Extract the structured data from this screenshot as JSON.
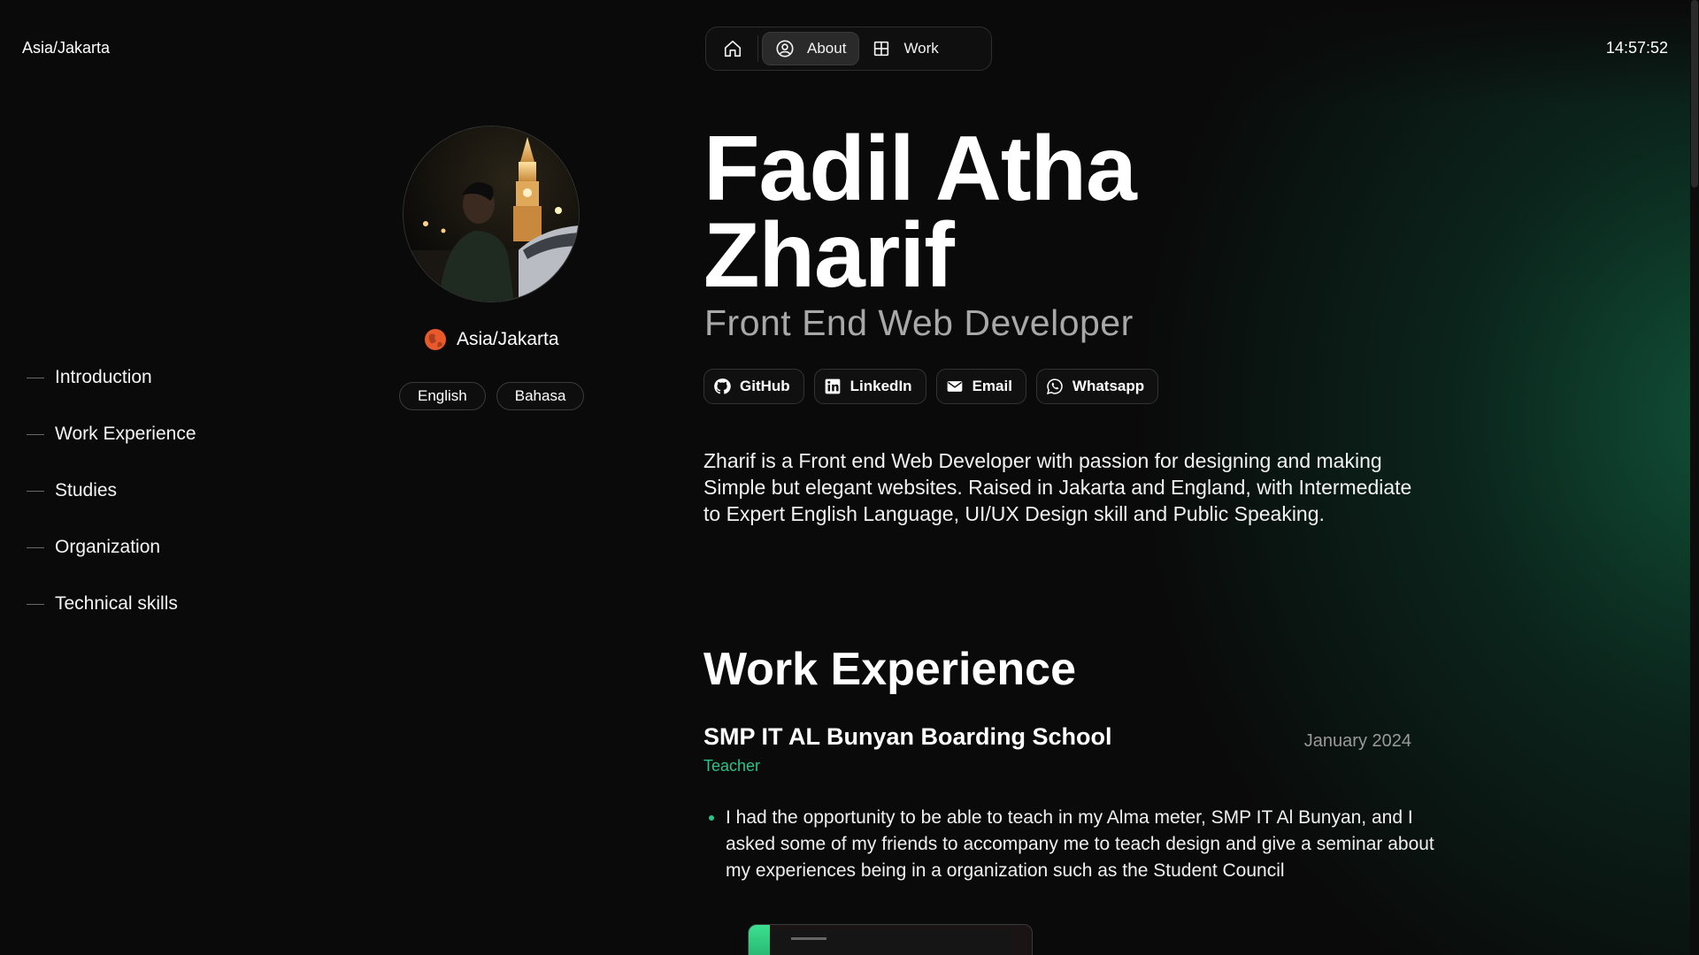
{
  "header": {
    "timezone": "Asia/Jakarta",
    "clock": "14:57:52"
  },
  "nav": {
    "items": [
      {
        "icon": "home-icon",
        "label": ""
      },
      {
        "icon": "user-circle-icon",
        "label": "About",
        "active": true
      },
      {
        "icon": "grid-icon",
        "label": "Work"
      }
    ]
  },
  "toc": {
    "items": [
      "Introduction",
      "Work Experience",
      "Studies",
      "Organization",
      "Technical skills"
    ]
  },
  "profile": {
    "location": "Asia/Jakarta",
    "languages": [
      "English",
      "Bahasa"
    ]
  },
  "intro": {
    "name": "Fadil Atha Zharif",
    "role": "Front End Web Developer",
    "socials": [
      "GitHub",
      "LinkedIn",
      "Email",
      "Whatsapp"
    ],
    "bio": "Zharif is a Front end Web Developer with passion for designing and making Simple but elegant websites. Raised in Jakarta and England, with Intermediate to Expert English Language, UI/UX Design skill and Public Speaking."
  },
  "work": {
    "title": "Work Experience",
    "jobs": [
      {
        "company": "SMP IT AL Bunyan Boarding School",
        "date": "January 2024",
        "role": "Teacher",
        "bullets": [
          "I had the opportunity to be able to teach in my Alma meter, SMP IT Al Bunyan, and I asked some of my friends to accompany me to teach design and give a seminar about my experiences being in a organization such as the Student Council"
        ]
      }
    ]
  },
  "colors": {
    "background": "#0a0a0a",
    "accent": "#2bc38a",
    "glow": "#125c40",
    "globe": "#e8592b"
  }
}
